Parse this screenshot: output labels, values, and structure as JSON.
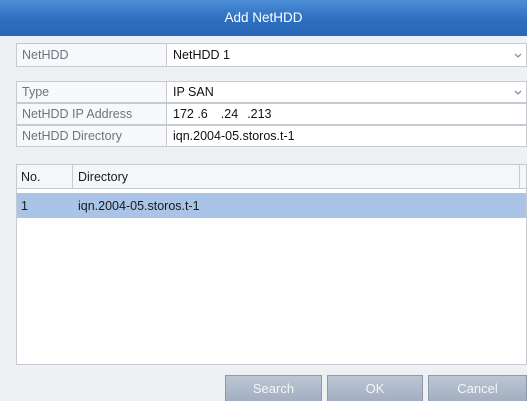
{
  "dialog": {
    "title": "Add NetHDD"
  },
  "form": {
    "nethdd": {
      "label": "NetHDD",
      "value": "NetHDD 1"
    },
    "type": {
      "label": "Type",
      "value": "IP SAN"
    },
    "ip": {
      "label": "NetHDD IP Address",
      "octets": [
        "172 .6",
        ".24",
        ".213"
      ]
    },
    "directory": {
      "label": "NetHDD Directory",
      "value": "iqn.2004-05.storos.t-1"
    }
  },
  "table": {
    "columns": [
      "No.",
      "Directory"
    ],
    "rows": [
      {
        "no": "1",
        "directory": "iqn.2004-05.storos.t-1"
      }
    ]
  },
  "buttons": {
    "search": "Search",
    "ok": "OK",
    "cancel": "Cancel"
  },
  "icons": {
    "dropdown": "chevron-down-icon"
  }
}
